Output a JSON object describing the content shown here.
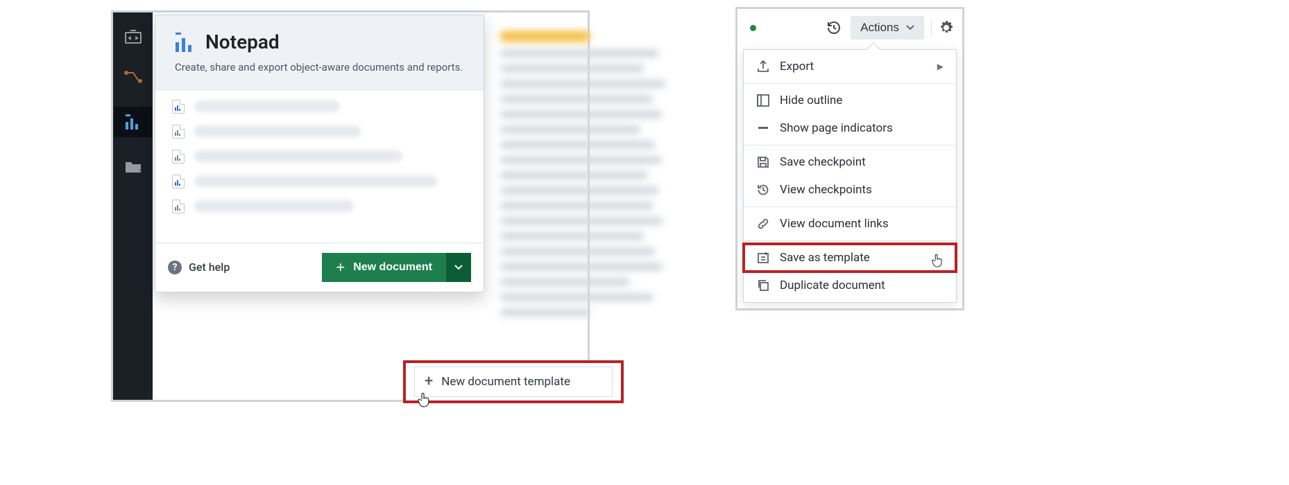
{
  "notepad_panel": {
    "title": "Notepad",
    "subtitle": "Create, share and export object-aware documents and reports.",
    "get_help": "Get help",
    "new_document": "New document",
    "new_document_template": "New document template"
  },
  "actions_menu": {
    "button": "Actions",
    "export": "Export",
    "hide_outline": "Hide outline",
    "show_page_indicators": "Show page indicators",
    "save_checkpoint": "Save checkpoint",
    "view_checkpoints": "View checkpoints",
    "view_document_links": "View document links",
    "save_as_template": "Save as template",
    "duplicate_document": "Duplicate document"
  }
}
